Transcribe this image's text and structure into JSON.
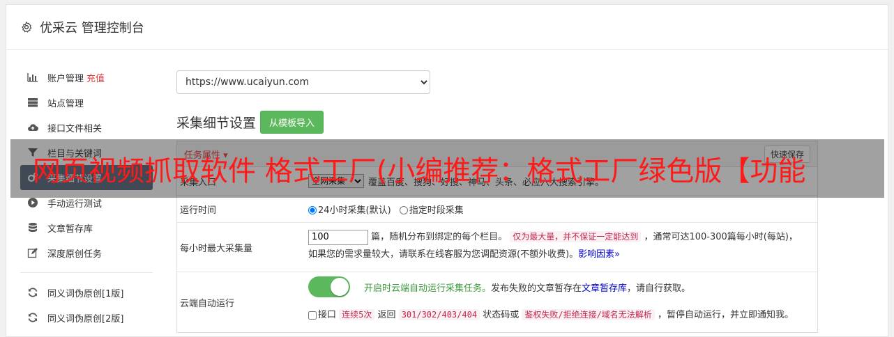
{
  "header": {
    "title": "优采云 管理控制台",
    "icon": "gear-icon"
  },
  "sidebar": {
    "items": [
      {
        "label": "账户管理",
        "badge": "充值",
        "icon": "bar-chart-icon"
      },
      {
        "label": "站点管理",
        "icon": "server-icon"
      },
      {
        "label": "接口文件相关",
        "icon": "cloud-upload-icon"
      },
      {
        "label": "栏目与关键词",
        "icon": "filter-icon"
      },
      {
        "label": "采集细节设置",
        "icon": "gears-icon",
        "active": true
      },
      {
        "label": "手动运行测试",
        "icon": "play-circle-icon"
      },
      {
        "label": "文章暂存库",
        "icon": "database-icon"
      },
      {
        "label": "深度原创任务",
        "icon": "edit-icon"
      },
      {
        "label": "同义词伪原创[1版]",
        "icon": "refresh-icon"
      },
      {
        "label": "同义词伪原创[2版]",
        "icon": "refresh-icon"
      }
    ]
  },
  "main": {
    "site_select": {
      "value": "https://www.ucaiyun.com"
    },
    "section_title": "采集细节设置",
    "import_button": "从模板导入",
    "table": {
      "head_link": "任务属性",
      "quick_save": "快速保存",
      "rows": {
        "source": {
          "label": "采集入口",
          "select_value": "全网采集",
          "desc": "覆盖百度、搜狗、好搜、神马、头条、必应六大搜索引擎。"
        },
        "runtime": {
          "label": "运行时间",
          "opt1": "24小时采集(默认)",
          "opt2": "指定时段采集"
        },
        "max_per_hour": {
          "label": "每小时最大采集量",
          "input_value": "100",
          "text1": "篇，随机分布到绑定的每个栏目。",
          "tag1": "仅为最大量，并不保证一定能达到",
          "text2": "，通常可达100-300篇每小时(每站)，",
          "text3": "如果您的需求量较大，请联系在线客服为您调配资源(不额外收费)。",
          "link": "影响因素",
          "link_icon": "double-chevron-down-icon"
        },
        "cloud_run": {
          "label": "云端自动运行",
          "text_green": "开启时云端自动运行采集任务。",
          "text_a": "发布失败的文章暂存在",
          "link": "文章暂存库",
          "text_b": "，请自行获取。",
          "cb_label": "接口",
          "tag1": "连续5次",
          "text_c": "返回",
          "tag2": "301/302/403/404",
          "text_d": "状态码或",
          "tag3": "鉴权失败/拒绝连接/域名无法解析",
          "text_e": "，暂停自动运行，并立即通知我。"
        }
      }
    }
  },
  "overlay": {
    "text": "网页视频抓取软件 格式工厂(小编推荐：格式工厂绿色版【功能"
  },
  "colors": {
    "accent_red": "#e4393c",
    "green": "#5cb85c",
    "active_nav": "#596a7e"
  }
}
